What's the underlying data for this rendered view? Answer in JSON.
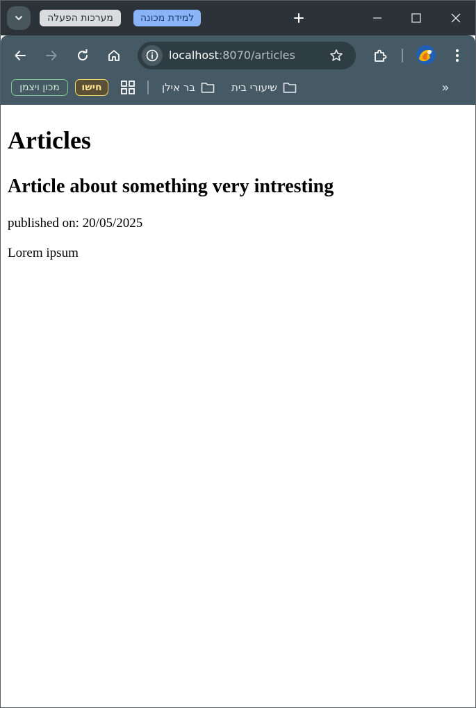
{
  "tabs": {
    "tab_groups": [
      {
        "label": "מערכות הפעלה",
        "color": "#dadce0"
      },
      {
        "label": "למידת מכונה",
        "color": "#8ab4f8"
      }
    ]
  },
  "toolbar": {
    "url_host": "localhost",
    "url_path": ":8070/articles"
  },
  "bookmarks": {
    "chips": [
      {
        "label": "מכון ויצמן",
        "color": "#81c995"
      },
      {
        "label": "חישו",
        "color": "#fdd663"
      }
    ],
    "folders": [
      {
        "label": "בר אילן"
      },
      {
        "label": "שיעורי בית"
      }
    ],
    "more_label": "»"
  },
  "page": {
    "heading": "Articles",
    "article_title": "Article about something very intresting",
    "published": "published on: 20/05/2025",
    "body": "Lorem ipsum"
  }
}
